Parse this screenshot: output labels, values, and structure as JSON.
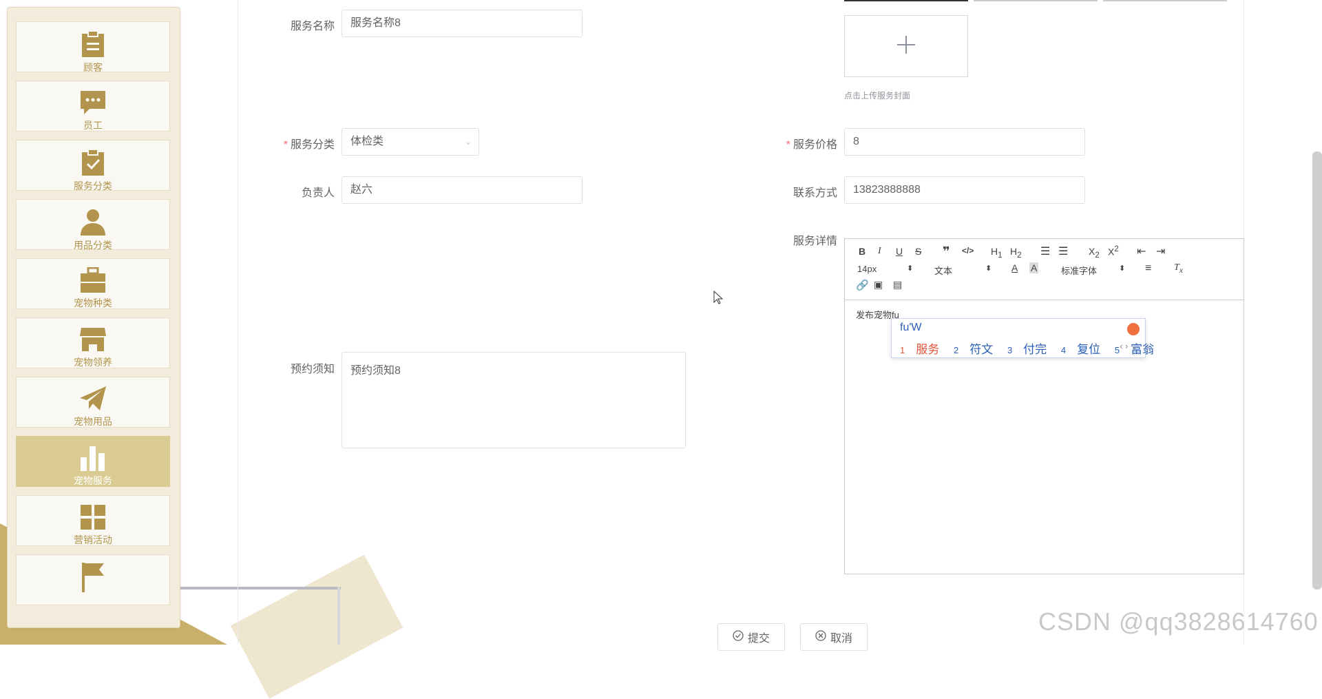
{
  "sidebar": {
    "items": [
      {
        "label": "顾客",
        "icon": "clipboard-icon"
      },
      {
        "label": "员工",
        "icon": "chat-icon"
      },
      {
        "label": "服务分类",
        "icon": "checklist-icon"
      },
      {
        "label": "用品分类",
        "icon": "user-icon"
      },
      {
        "label": "宠物种类",
        "icon": "briefcase-icon"
      },
      {
        "label": "宠物领养",
        "icon": "store-icon"
      },
      {
        "label": "宠物用品",
        "icon": "paper-plane-icon"
      },
      {
        "label": "宠物服务",
        "icon": "bar-chart-icon",
        "active": true
      },
      {
        "label": "营销活动",
        "icon": "grid-icon"
      },
      {
        "label": "",
        "icon": "flag-icon"
      }
    ]
  },
  "form": {
    "service_name": {
      "label": "服务名称",
      "value": "服务名称8"
    },
    "cover": {
      "hint": "点击上传服务封面"
    },
    "category": {
      "label": "服务分类",
      "value": "体检类",
      "required": true
    },
    "price": {
      "label": "服务价格",
      "value": "8",
      "required": true
    },
    "owner": {
      "label": "负责人",
      "value": "赵六"
    },
    "contact": {
      "label": "联系方式",
      "value": "13823888888"
    },
    "details": {
      "label": "服务详情"
    },
    "booking": {
      "label": "预约须知",
      "value": "预约须知8"
    }
  },
  "editor": {
    "font_size": "14px",
    "paragraph": "文本",
    "font_family": "标准字体",
    "content": "发布宠物fu"
  },
  "ime": {
    "input": "fu'W",
    "candidates": [
      {
        "num": "1",
        "text": "服务"
      },
      {
        "num": "2",
        "text": "符文"
      },
      {
        "num": "3",
        "text": "付完"
      },
      {
        "num": "4",
        "text": "复位"
      },
      {
        "num": "5",
        "text": "富翁"
      }
    ]
  },
  "buttons": {
    "submit": "提交",
    "cancel": "取消"
  },
  "watermark": "CSDN @qq3828614760"
}
